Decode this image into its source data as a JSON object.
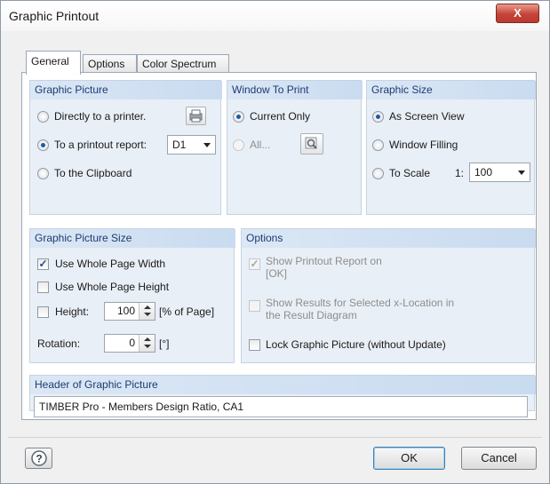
{
  "window": {
    "title": "Graphic Printout",
    "close_label": "X"
  },
  "tabs": [
    {
      "label": "General"
    },
    {
      "label": "Options"
    },
    {
      "label": "Color Spectrum"
    }
  ],
  "graphic_picture": {
    "header": "Graphic Picture",
    "directly_printer_label": "Directly to a printer.",
    "printout_report_label": "To a printout report:",
    "printout_report_value": "D1",
    "clipboard_label": "To the Clipboard",
    "selected": "printout_report"
  },
  "window_to_print": {
    "header": "Window To Print",
    "current_only_label": "Current Only",
    "all_label": "All..."
  },
  "graphic_size": {
    "header": "Graphic Size",
    "as_screen_view_label": "As Screen View",
    "window_filling_label": "Window Filling",
    "to_scale_label": "To Scale",
    "scale_prefix": "1:",
    "scale_value": "100"
  },
  "graphic_picture_size": {
    "header": "Graphic Picture Size",
    "use_whole_width_label": "Use Whole Page Width",
    "use_whole_width_checked": true,
    "use_whole_height_label": "Use Whole Page Height",
    "height_label": "Height:",
    "height_value": "100",
    "height_unit": "[% of Page]",
    "rotation_label": "Rotation:",
    "rotation_value": "0",
    "rotation_unit": "[°]"
  },
  "options": {
    "header": "Options",
    "show_printout_line1": "Show Printout Report on",
    "show_printout_line2": "[OK]",
    "show_results_line1": "Show Results for Selected x-Location in",
    "show_results_line2": "the Result Diagram",
    "lock_graphic_label": "Lock Graphic Picture (without Update)"
  },
  "header_of_picture": {
    "header": "Header of Graphic Picture",
    "value": "TIMBER Pro - Members Design Ratio, CA1"
  },
  "footer": {
    "help_icon": "question-icon",
    "ok_label": "OK",
    "cancel_label": "Cancel"
  },
  "colors": {
    "group_bg": "#e9eff6",
    "header_text": "#1d3b72",
    "accent": "#1f5aa6"
  }
}
